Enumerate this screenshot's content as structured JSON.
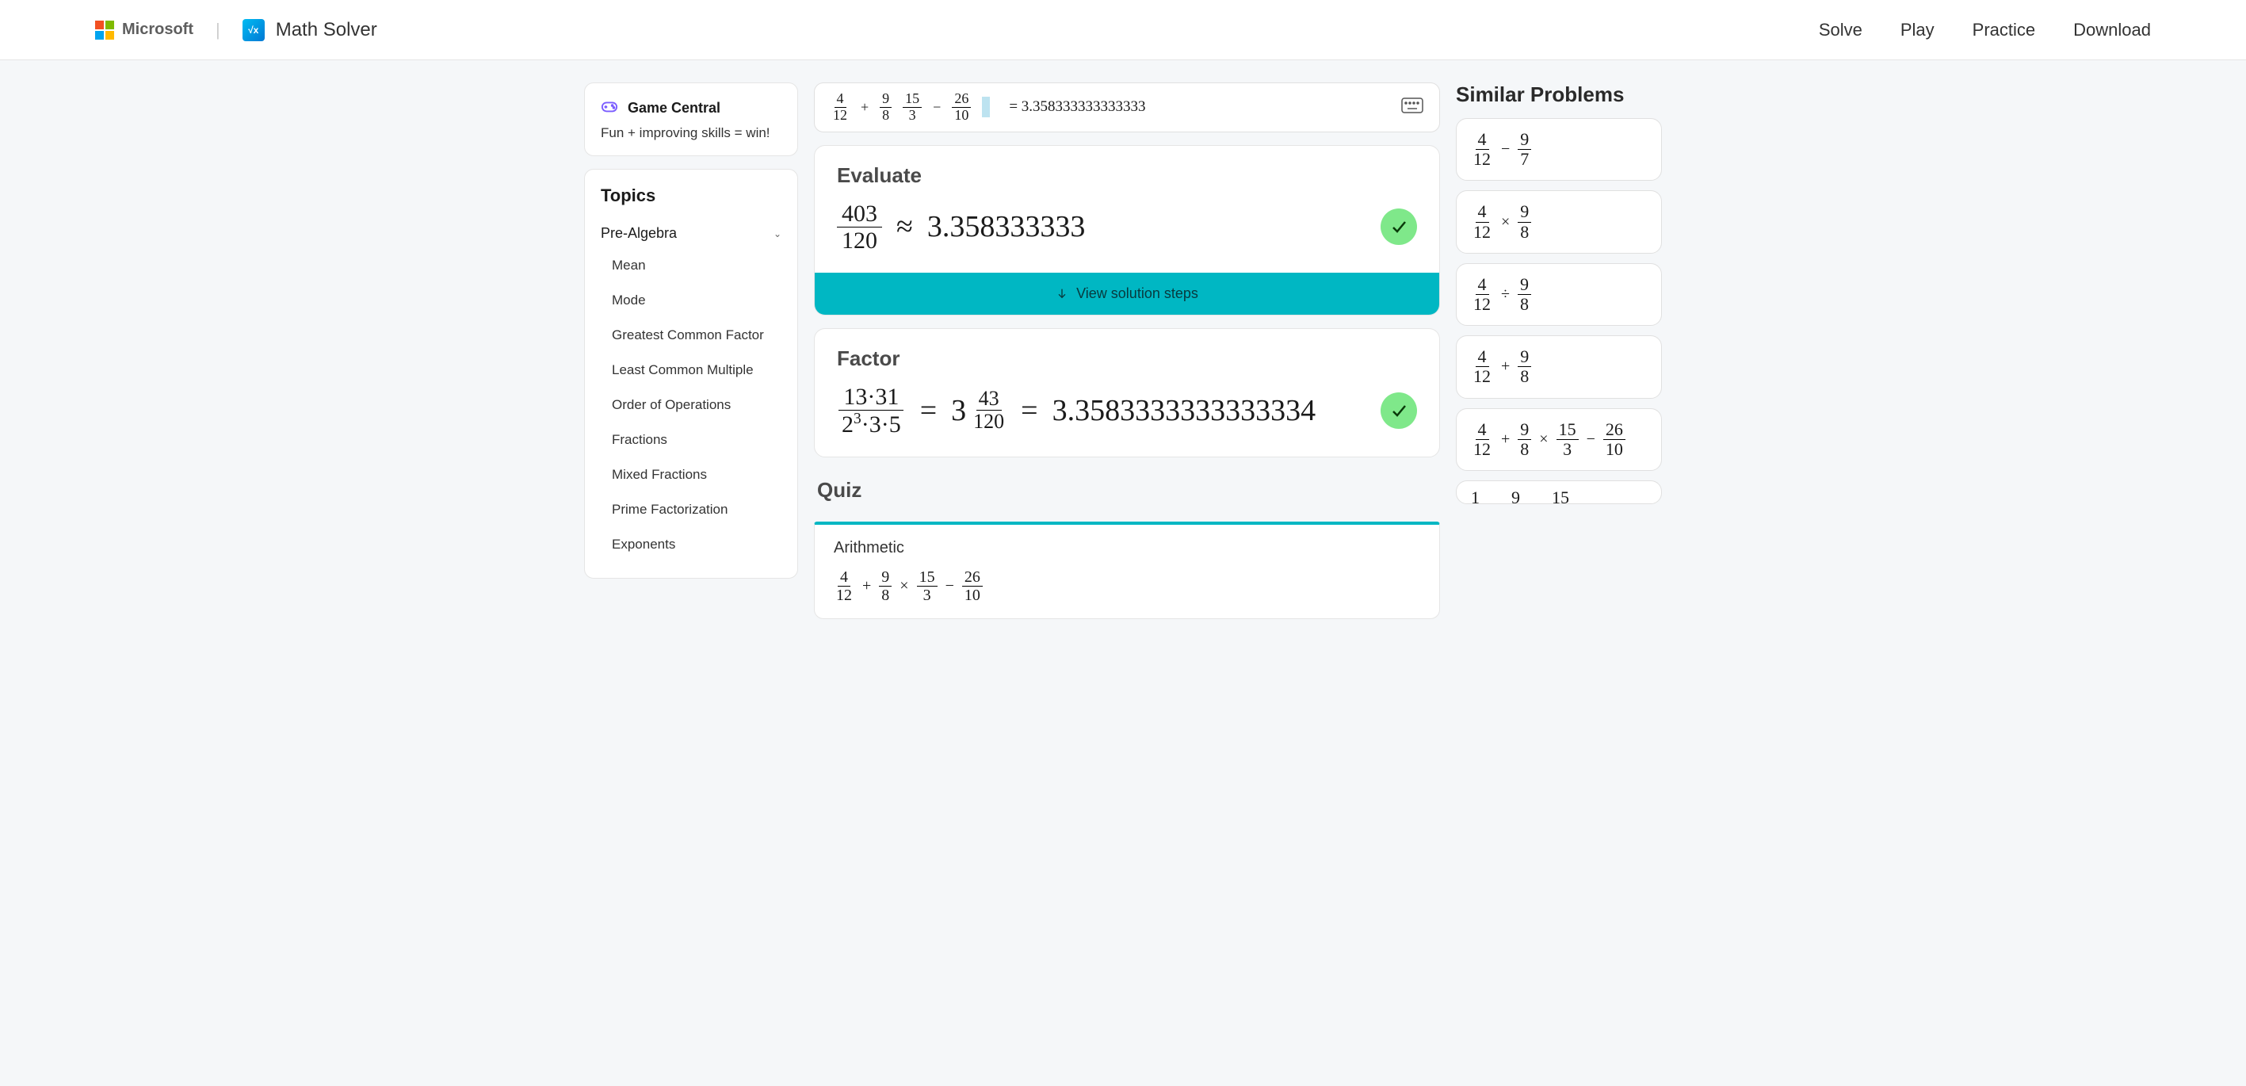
{
  "header": {
    "microsoft": "Microsoft",
    "app_name": "Math Solver",
    "nav": [
      "Solve",
      "Play",
      "Practice",
      "Download"
    ]
  },
  "sidebar": {
    "game": {
      "title": "Game Central",
      "subtitle": "Fun + improving skills = win!"
    },
    "topics_title": "Topics",
    "category": "Pre-Algebra",
    "items": [
      "Mean",
      "Mode",
      "Greatest Common Factor",
      "Least Common Multiple",
      "Order of Operations",
      "Fractions",
      "Mixed Fractions",
      "Prime Factorization",
      "Exponents"
    ]
  },
  "input": {
    "terms": [
      {
        "num": "4",
        "den": "12"
      },
      {
        "op": "+"
      },
      {
        "num": "9",
        "den": "8"
      },
      {
        "num": "15",
        "den": "3"
      },
      {
        "op": "−"
      },
      {
        "num": "26",
        "den": "10"
      }
    ],
    "result": "= 3.358333333333333"
  },
  "evaluate": {
    "title": "Evaluate",
    "frac_num": "403",
    "frac_den": "120",
    "approx": "≈",
    "value": "3.358333333",
    "steps_label": "View solution steps"
  },
  "factor": {
    "title": "Factor",
    "lhs_num": "13·31",
    "lhs_den_a": "2",
    "lhs_den_exp": "3",
    "lhs_den_rest": "·3·5",
    "eq": "=",
    "mixed_whole": "3",
    "mixed_num": "43",
    "mixed_den": "120",
    "value": "3.3583333333333334"
  },
  "quiz": {
    "title": "Quiz",
    "category": "Arithmetic",
    "terms": [
      {
        "num": "4",
        "den": "12"
      },
      {
        "op": "+"
      },
      {
        "num": "9",
        "den": "8"
      },
      {
        "op": "×"
      },
      {
        "num": "15",
        "den": "3"
      },
      {
        "op": "−"
      },
      {
        "num": "26",
        "den": "10"
      }
    ]
  },
  "similar": {
    "title": "Similar Problems",
    "items": [
      [
        {
          "num": "4",
          "den": "12"
        },
        {
          "op": "−"
        },
        {
          "num": "9",
          "den": "7"
        }
      ],
      [
        {
          "num": "4",
          "den": "12"
        },
        {
          "op": "×"
        },
        {
          "num": "9",
          "den": "8"
        }
      ],
      [
        {
          "num": "4",
          "den": "12"
        },
        {
          "op": "÷"
        },
        {
          "num": "9",
          "den": "8"
        }
      ],
      [
        {
          "num": "4",
          "den": "12"
        },
        {
          "op": "+"
        },
        {
          "num": "9",
          "den": "8"
        }
      ],
      [
        {
          "num": "4",
          "den": "12"
        },
        {
          "op": "+"
        },
        {
          "num": "9",
          "den": "8"
        },
        {
          "op": "×"
        },
        {
          "num": "15",
          "den": "3"
        },
        {
          "op": "−"
        },
        {
          "num": "26",
          "den": "10"
        }
      ],
      [
        {
          "num": "1",
          "den": ""
        },
        {
          "txt": ""
        },
        {
          "num": "9",
          "den": ""
        },
        {
          "txt": ""
        },
        {
          "num": "15",
          "den": ""
        }
      ]
    ]
  }
}
